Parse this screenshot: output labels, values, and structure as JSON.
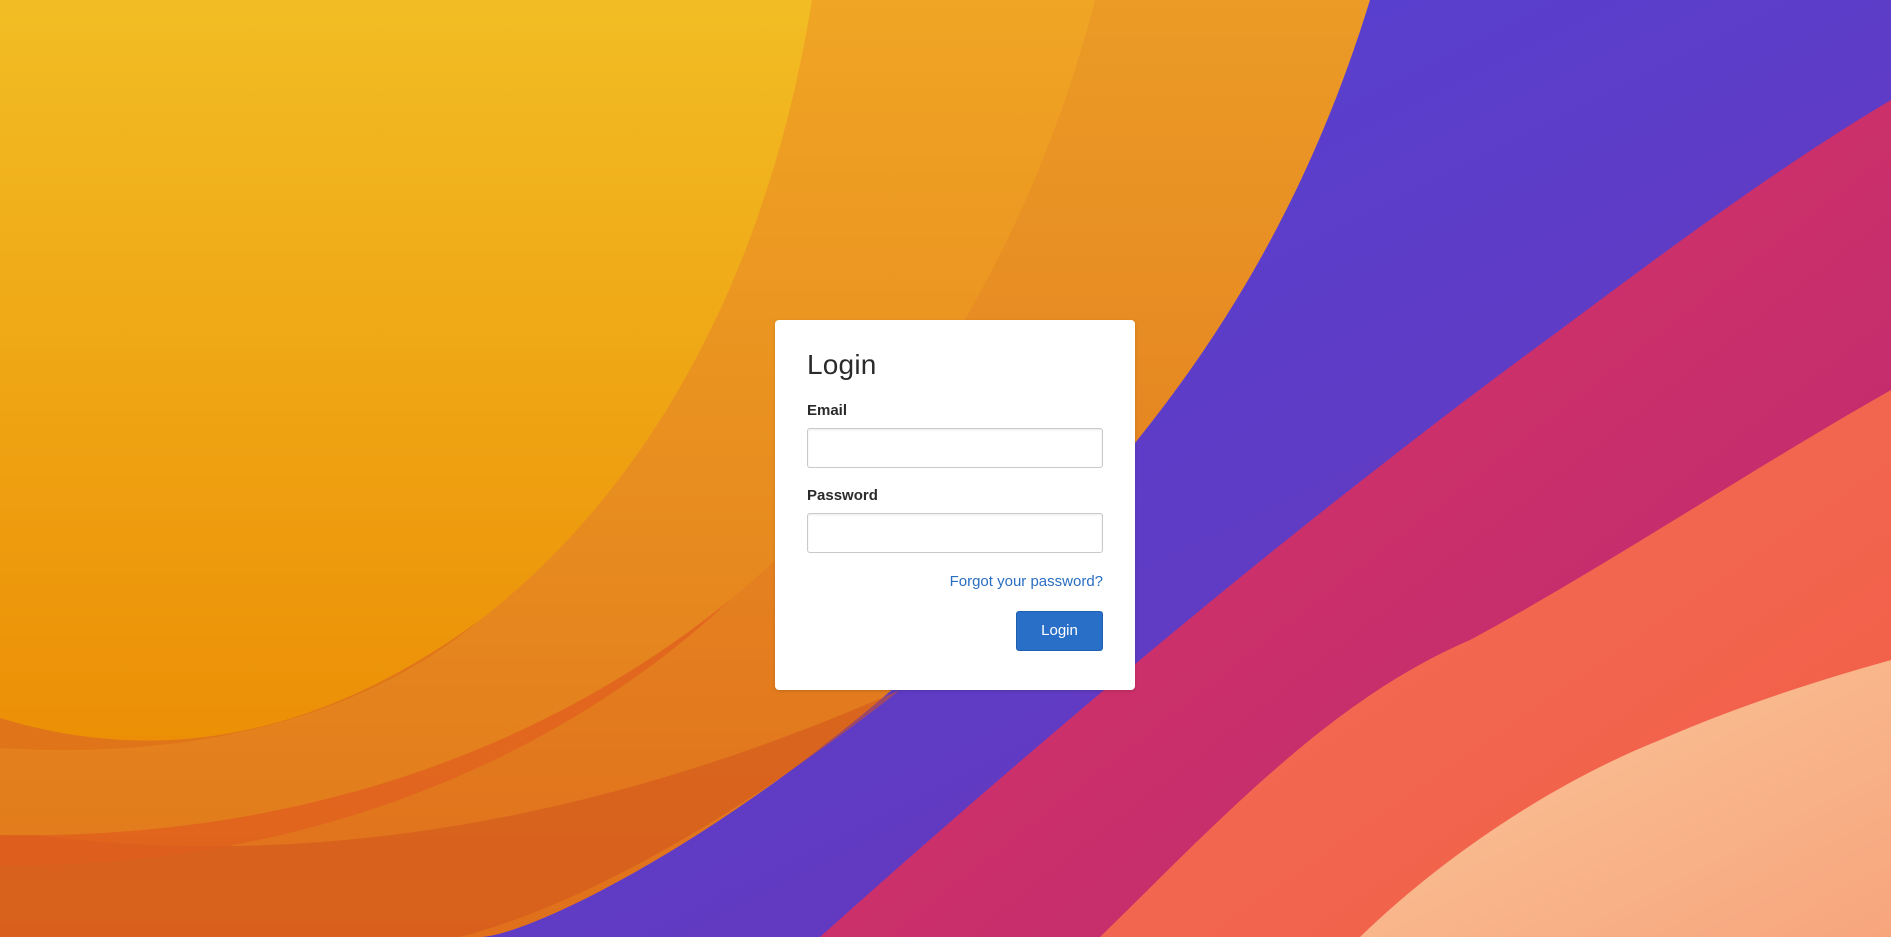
{
  "login_form": {
    "title": "Login",
    "email_label": "Email",
    "email_value": "",
    "password_label": "Password",
    "password_value": "",
    "forgot_link": "Forgot your password?",
    "submit_label": "Login"
  },
  "theme": {
    "accent": "#2a6fc7",
    "link": "#2a6ec2",
    "wallpaper_colors": [
      "#f1bb22",
      "#ec9a1a",
      "#e6822a",
      "#5045d6",
      "#d43366",
      "#f2644c",
      "#f9b387"
    ]
  }
}
